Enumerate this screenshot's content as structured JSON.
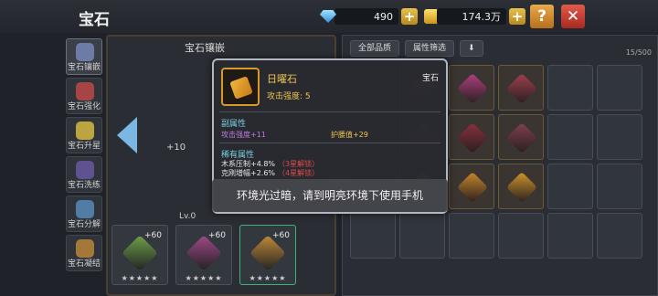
{
  "header": {
    "title": "宝石",
    "diamonds": "490",
    "gold": "174.3万",
    "help_label": "?",
    "close_label": "✕"
  },
  "sidetabs": [
    {
      "label": "宝石镶嵌",
      "icon": "gem-socket-icon",
      "color": "#7a8bbf"
    },
    {
      "label": "宝石强化",
      "icon": "gem-upgrade-icon",
      "color": "#c44a4a"
    },
    {
      "label": "宝石升星",
      "icon": "star-icon",
      "color": "#e0c040"
    },
    {
      "label": "宝石洗练",
      "icon": "refine-icon",
      "color": "#6b5aa8"
    },
    {
      "label": "宝石分解",
      "icon": "decompose-icon",
      "color": "#5a8fc0"
    },
    {
      "label": "宝石凝结",
      "icon": "condense-icon",
      "color": "#c08a3a"
    }
  ],
  "left_panel": {
    "header": "宝石镶嵌",
    "plus_label": "+10",
    "slot_pill": "Lv.0",
    "bottom_slots": [
      {
        "bonus": "+60",
        "stars": "★★★★★",
        "color": "#6ea04a"
      },
      {
        "bonus": "+60",
        "stars": "★★★★★",
        "color": "#a04a8a"
      },
      {
        "bonus": "+60",
        "stars": "★★★★★",
        "color": "#c08a3a"
      }
    ]
  },
  "right_panel": {
    "filter_all": "全部品质",
    "filter_attr": "属性筛选",
    "sort_label": "⬇",
    "count": "15/500",
    "cells": [
      {
        "filled": false
      },
      {
        "filled": true,
        "color": "#c44a6a"
      },
      {
        "filled": true,
        "color": "#b04080"
      },
      {
        "filled": true,
        "color": "#a04050"
      },
      {
        "filled": false
      },
      {
        "filled": false
      },
      {
        "filled": false
      },
      {
        "filled": true,
        "color": "#a04060"
      },
      {
        "filled": true,
        "color": "#8a3040"
      },
      {
        "filled": true,
        "color": "#804050"
      },
      {
        "filled": false
      },
      {
        "filled": false
      },
      {
        "filled": false
      },
      {
        "filled": true,
        "color": "#d89a2a"
      },
      {
        "filled": true,
        "color": "#c8892a"
      },
      {
        "filled": true,
        "color": "#d0962a"
      },
      {
        "filled": false
      },
      {
        "filled": false
      },
      {
        "filled": false
      },
      {
        "filled": false
      },
      {
        "filled": false
      },
      {
        "filled": false
      },
      {
        "filled": false
      },
      {
        "filled": false
      }
    ]
  },
  "tooltip": {
    "name": "日曜石",
    "type": "宝石",
    "main_stat": "攻击强度: 5",
    "sub_title": "副属性",
    "sub_left": "攻击强度+11",
    "sub_right": "护腰值+29",
    "rare_title": "稀有属性",
    "rare_1": "木系压制+4.8%",
    "rare_1_lock": "（3星解锁）",
    "rare_2": "克刚增幅+2.6%",
    "rare_2_lock": "（4星解锁）"
  },
  "toast": "环境光过暗，请到明亮环境下使用手机"
}
